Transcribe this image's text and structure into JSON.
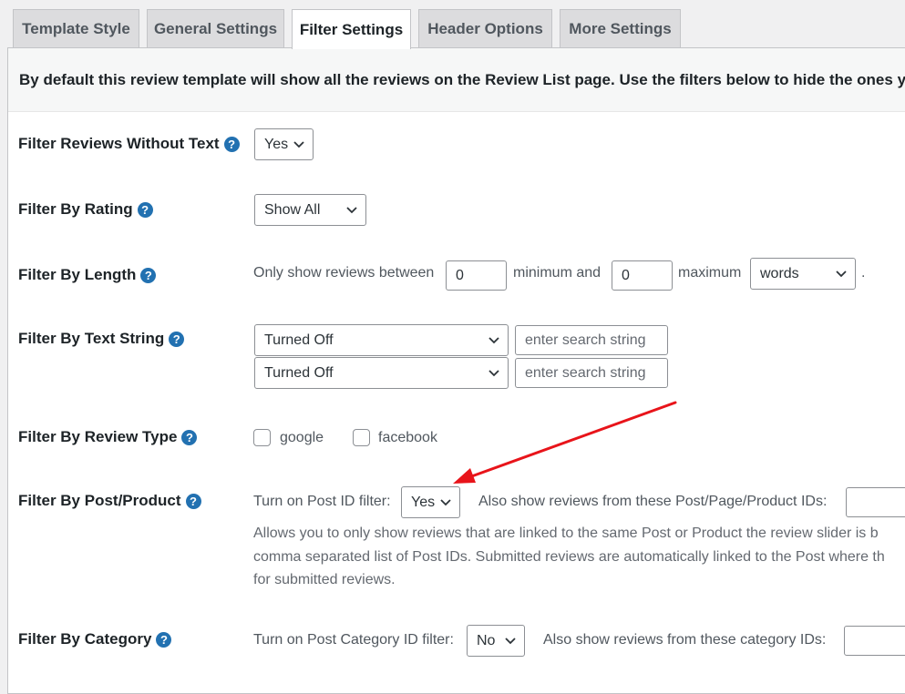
{
  "tabs": [
    {
      "label": "Template Style"
    },
    {
      "label": "General Settings"
    },
    {
      "label": "Filter Settings"
    },
    {
      "label": "Header Options"
    },
    {
      "label": "More Settings"
    }
  ],
  "intro_text": "By default this review template will show all the reviews on the Review List page. Use the filters below to hide the ones you do n",
  "help_glyph": "?",
  "rows": {
    "without_text": {
      "label": "Filter Reviews Without Text",
      "value": "Yes"
    },
    "rating": {
      "label": "Filter By Rating",
      "value": "Show All"
    },
    "length": {
      "label": "Filter By Length",
      "prefix": "Only show reviews between",
      "min_value": "0",
      "min_label": "minimum and",
      "max_value": "0",
      "max_label": "maximum",
      "unit": "words",
      "suffix": "."
    },
    "text_string": {
      "label": "Filter By Text String",
      "select1": "Turned Off",
      "input1_placeholder": "enter search string",
      "select2": "Turned Off",
      "input2_placeholder": "enter search string"
    },
    "review_type": {
      "label": "Filter By Review Type",
      "option1": "google",
      "option2": "facebook"
    },
    "post_product": {
      "label": "Filter By Post/Product",
      "toggle_label": "Turn on Post ID filter:",
      "toggle_value": "Yes",
      "also_label": "Also show reviews from these Post/Page/Product IDs:",
      "desc1": "Allows you to only show reviews that are linked to the same Post or Product the review slider is b",
      "desc2": "comma separated list of Post IDs. Submitted reviews are automatically linked to the Post where th",
      "desc3": "for submitted reviews."
    },
    "category": {
      "label": "Filter By Category",
      "toggle_label": "Turn on Post Category ID filter:",
      "toggle_value": "No",
      "also_label": "Also show reviews from these category IDs:"
    }
  },
  "colors": {
    "accent": "#2271b1",
    "arrow": "#e8141a"
  }
}
